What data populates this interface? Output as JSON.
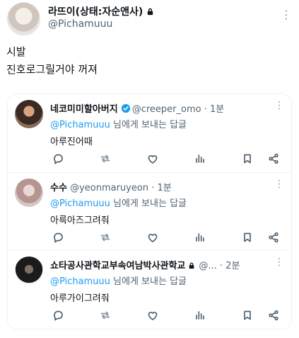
{
  "post": {
    "author_name": "라뜨이(상태:자순앤사)",
    "author_handle": "@Pichamuuu",
    "text_line1": "시발",
    "text_line2": "진호로그릴거야 꺼져"
  },
  "replies": [
    {
      "name": "네코미미할아버지",
      "handle": "@creeper_omo",
      "time": "· 1분",
      "replying_prefix": "",
      "mention": "@Pichamuuu",
      "replying_suffix": " 님에게 보내는 답글",
      "text": "아루진어때"
    },
    {
      "name": "수수",
      "handle": "@yeonmaruyeon",
      "time": "· 1분",
      "replying_prefix": "",
      "mention": "@Pichamuuu",
      "replying_suffix": " 님에게 보내는 답글",
      "text": "아륵아즈그려줘"
    },
    {
      "name": "쇼타공사관학교부속여남박사관학교",
      "handle": "@...",
      "time": "· 2분",
      "replying_prefix": "",
      "mention": "@Pichamuuu",
      "replying_suffix": " 님에게 보내는 답글",
      "text": "아루가이그려줘"
    }
  ],
  "icons": {
    "more": "more-icon",
    "reply": "reply-icon",
    "retweet": "retweet-icon",
    "like": "heart-icon",
    "views": "views-icon",
    "bookmark": "bookmark-icon",
    "share": "share-icon"
  },
  "colors": {
    "accent": "#1d9bf0",
    "secondary_text": "#536471",
    "border": "#eff3f4"
  }
}
